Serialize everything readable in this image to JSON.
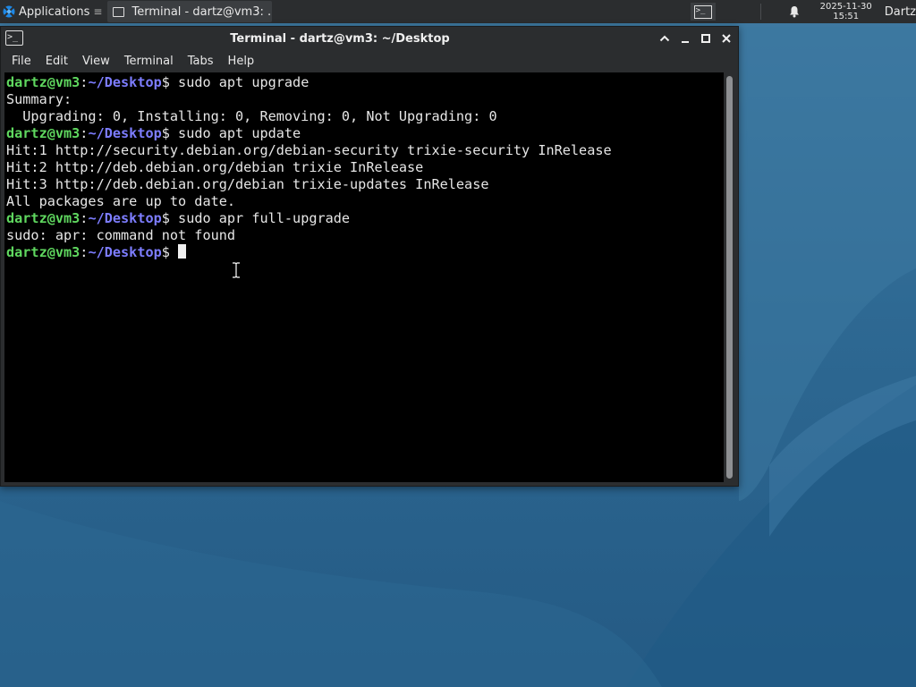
{
  "panel": {
    "applications_label": "Applications",
    "applications_sep": "≡",
    "task_label": "Terminal - dartz@vm3: ...",
    "clock_date": "2025-11-30",
    "clock_time": "15:51",
    "user_label": "Dartz",
    "terminal_launcher_glyph": ">_"
  },
  "window": {
    "title": "Terminal - dartz@vm3: ~/Desktop",
    "icon_glyph": ">_",
    "controls": {
      "up": "⌃",
      "minimize": "‒",
      "maximize": "□",
      "close": "✕"
    },
    "menu": [
      "File",
      "Edit",
      "View",
      "Terminal",
      "Tabs",
      "Help"
    ]
  },
  "terminal": {
    "prompt_user": "dartz@vm3",
    "prompt_colon": ":",
    "prompt_path": "~/Desktop",
    "prompt_symbol": "$",
    "lines": [
      {
        "type": "prompt",
        "cmd": " sudo apt upgrade"
      },
      {
        "type": "out",
        "text": "Summary:"
      },
      {
        "type": "out",
        "text": "  Upgrading: 0, Installing: 0, Removing: 0, Not Upgrading: 0"
      },
      {
        "type": "prompt",
        "cmd": " sudo apt update"
      },
      {
        "type": "out",
        "text": "Hit:1 http://security.debian.org/debian-security trixie-security InRelease"
      },
      {
        "type": "out",
        "text": "Hit:2 http://deb.debian.org/debian trixie InRelease"
      },
      {
        "type": "out",
        "text": "Hit:3 http://deb.debian.org/debian trixie-updates InRelease"
      },
      {
        "type": "out",
        "text": "All packages are up to date."
      },
      {
        "type": "prompt",
        "cmd": " sudo apr full-upgrade"
      },
      {
        "type": "out",
        "text": "sudo: apr: command not found"
      },
      {
        "type": "prompt",
        "cmd": " ",
        "cursor": true
      }
    ]
  },
  "icons": {
    "applications": "xfce-mouse-icon",
    "task": "terminal-icon",
    "notifications": "bell-icon"
  },
  "colors": {
    "prompt_user": "#5fd75f",
    "prompt_path": "#7d7dff",
    "terminal_bg": "#000000",
    "panel_bg": "#2b2d2f"
  }
}
